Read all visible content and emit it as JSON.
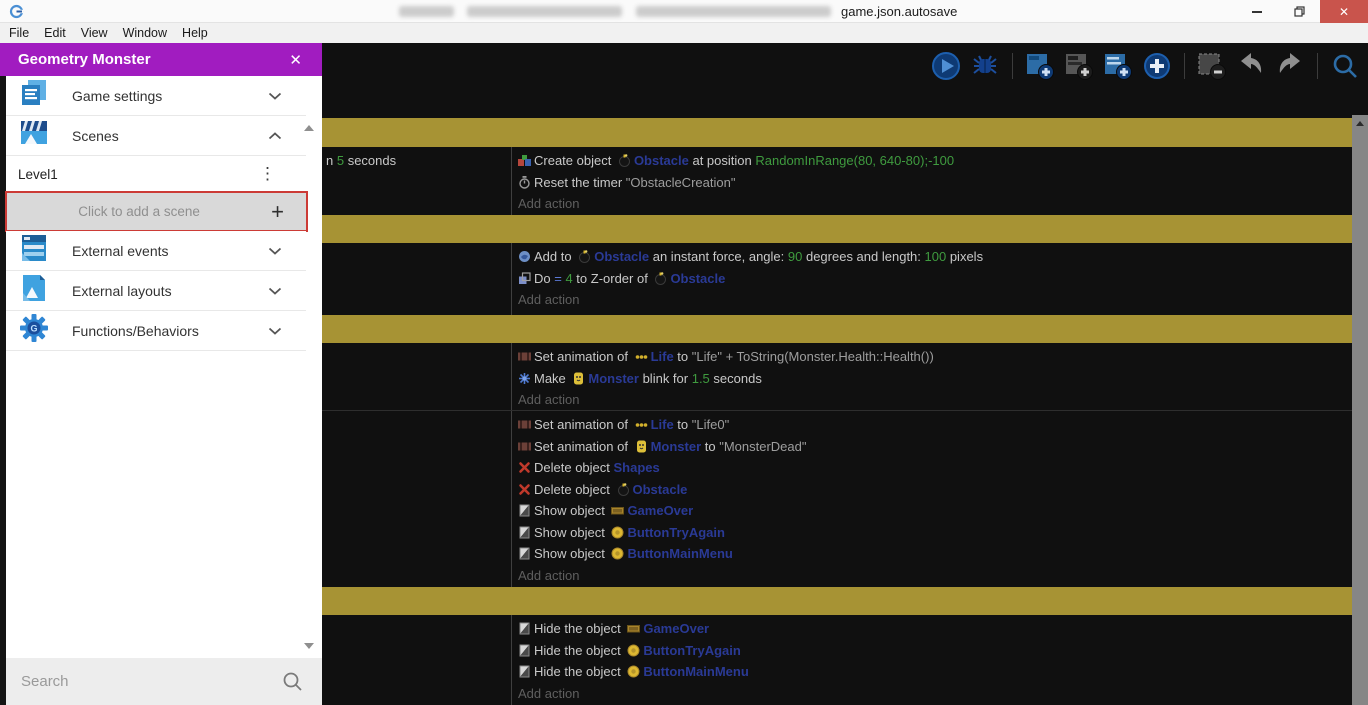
{
  "window": {
    "title": "game.json.autosave"
  },
  "menu": {
    "items": [
      "File",
      "Edit",
      "View",
      "Window",
      "Help"
    ]
  },
  "drawer": {
    "title": "Geometry Monster",
    "sections": [
      {
        "label": "Game settings"
      },
      {
        "label": "Scenes"
      },
      {
        "label": "External events"
      },
      {
        "label": "External layouts"
      },
      {
        "label": "Functions/Behaviors"
      }
    ],
    "scene_name": "Level1",
    "add_scene_label": "Click to add a scene",
    "search_placeholder": "Search"
  },
  "toolbar": {
    "icons": [
      "play",
      "debug",
      "add-event",
      "add-sub-event",
      "add-comment",
      "add-new-event",
      "remove-event",
      "undo",
      "redo",
      "search"
    ]
  },
  "icon_names": [
    "create-object",
    "bomb",
    "timer",
    "force",
    "z-order",
    "set-animation",
    "life-dots",
    "blink",
    "monster",
    "delete-cross",
    "visibility",
    "game-over-banner",
    "yellow-button"
  ],
  "ev": {
    "cond1": [
      "n ",
      "5",
      " seconds"
    ],
    "e1a1": [
      "Create object ",
      "Obstacle",
      " at position ",
      "RandomInRange(80, 640-80);-100"
    ],
    "e1a2": [
      "Reset the timer ",
      "\"ObstacleCreation\""
    ],
    "e2a1": [
      "Add to ",
      "Obstacle",
      " an instant force, angle: ",
      "90",
      " degrees and length: ",
      "100",
      " pixels"
    ],
    "e2a2": [
      "Do ",
      "= ",
      "4",
      " to Z-order of ",
      "Obstacle"
    ],
    "e3a1": [
      "Set animation of ",
      "Life",
      " to ",
      "\"Life\" + ToString(Monster.Health::Health())"
    ],
    "e3a2": [
      "Make ",
      "Monster",
      " blink for ",
      "1.5",
      " seconds"
    ],
    "e4a1": [
      "Set animation of ",
      "Life",
      " to ",
      "\"Life0\""
    ],
    "e4a2": [
      "Set animation of ",
      "Monster",
      " to ",
      "\"MonsterDead\""
    ],
    "e4a3": [
      "Delete object ",
      "Shapes"
    ],
    "e4a4": [
      "Delete object ",
      "Obstacle"
    ],
    "e4a5": [
      "Show object ",
      "GameOver"
    ],
    "e4a6": [
      "Show object ",
      "ButtonTryAgain"
    ],
    "e4a7": [
      "Show object ",
      "ButtonMainMenu"
    ],
    "e5a1": [
      "Hide the object ",
      "GameOver"
    ],
    "e5a2": [
      "Hide the object ",
      "ButtonTryAgain"
    ],
    "e5a3": [
      "Hide the object ",
      "ButtonMainMenu"
    ],
    "add_action": "Add action"
  },
  "colors": {
    "accent_purple": "#a11cc0",
    "group_bar_olive": "#a79334",
    "object_name_blue": "#2a3a96",
    "expression_green": "#3f9b3f",
    "close_button_red": "#c9544c",
    "highlight_red": "#cc3b36"
  }
}
